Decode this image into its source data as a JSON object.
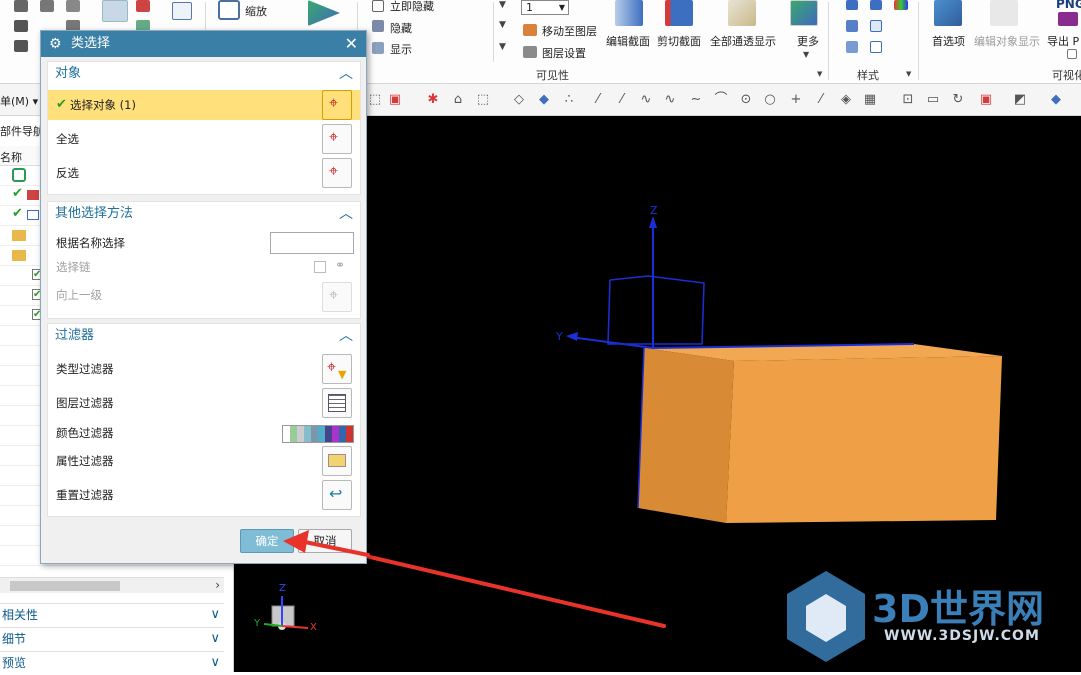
{
  "ribbon": {
    "zoom_label": "缩放",
    "hide_immediately": "立即隐藏",
    "hide": "隐藏",
    "show": "显示",
    "layer_select_value": "1",
    "move_to_layer": "移动至图层",
    "layer_settings": "图层设置",
    "edit_section": "编辑截面",
    "clip_section": "剪切截面",
    "show_all_through": "全部通透显示",
    "more": "更多",
    "visibility_group": "可见性",
    "style_group": "样式",
    "preferences": "首选项",
    "edit_object_display": "编辑对象显示",
    "export_label": "导出 P",
    "png_label": "PNG",
    "visualization_group": "可视化"
  },
  "left_nav": {
    "menu_label": "单(M)",
    "part_navigator_label": "部件导航",
    "name_column": "名称",
    "bottom_panels": [
      "相关性",
      "细节",
      "预览"
    ]
  },
  "dialog": {
    "title": "类选择",
    "object_section": {
      "title": "对象",
      "select_object": "选择对象 (1)",
      "select_all": "全选",
      "invert_selection": "反选"
    },
    "other_methods_section": {
      "title": "其他选择方法",
      "select_by_name": "根据名称选择",
      "name_input_value": "",
      "select_chain": "选择链",
      "up_one_level": "向上一级"
    },
    "filter_section": {
      "title": "过滤器",
      "type_filter": "类型过滤器",
      "layer_filter": "图层过滤器",
      "color_filter": "颜色过滤器",
      "attribute_filter": "属性过滤器",
      "reset_filter": "重置过滤器"
    },
    "ok_button": "确定",
    "cancel_button": "取消"
  },
  "viewport": {
    "axis_z": "Z",
    "axis_y": "Y",
    "axis_x": "X",
    "watermark_text": "3D世界网",
    "watermark_url": "WWW.3DSJW.COM"
  },
  "colors": {
    "title_bar": "#3a7fa6",
    "selected_row": "#ffe07a",
    "ok_button": "#7fbcd6",
    "box_face": "#f0a045",
    "box_side": "#d98a35",
    "arrow": "#e8332a"
  }
}
